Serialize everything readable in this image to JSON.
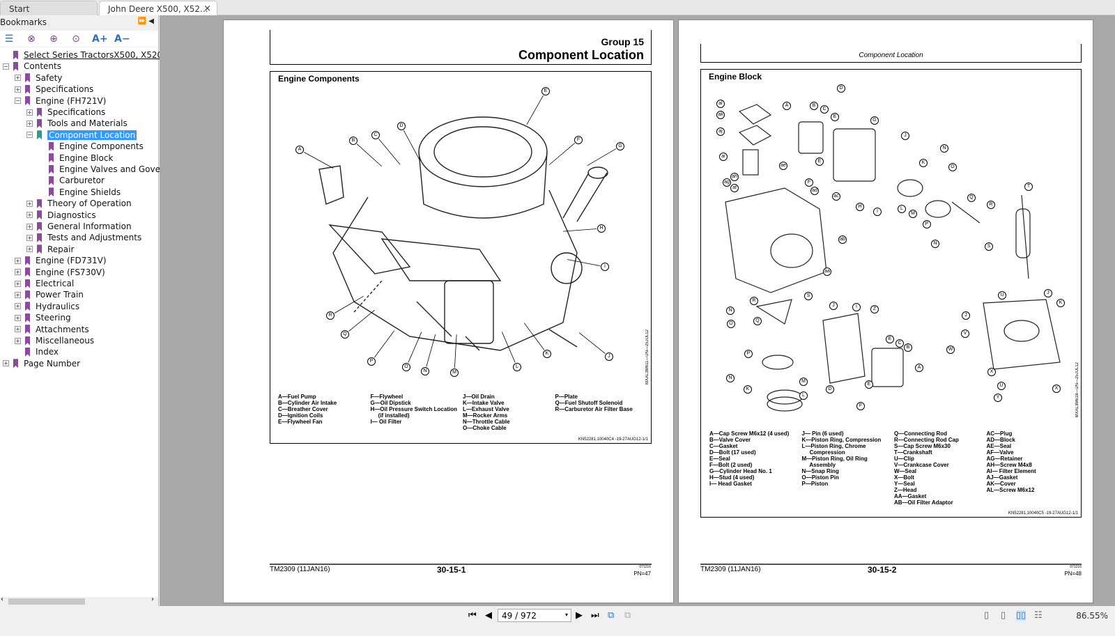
{
  "tabs": [
    {
      "label": "Start"
    },
    {
      "label": "John Deere X500, X52...",
      "close": "×"
    }
  ],
  "sidebar": {
    "title": "Bookmarks",
    "tools": [
      "bookmark-list",
      "remove-bookmark",
      "add-bookmark",
      "find-bookmark",
      "A+",
      "A−"
    ],
    "items": [
      {
        "label": "Select Series TractorsX500, X520, X5",
        "level": 0,
        "exp": "",
        "link": true
      },
      {
        "label": "Contents",
        "level": 0,
        "exp": "−"
      },
      {
        "label": "Safety",
        "level": 1,
        "exp": "+"
      },
      {
        "label": "Specifications",
        "level": 1,
        "exp": "+"
      },
      {
        "label": "Engine (FH721V)",
        "level": 1,
        "exp": "−"
      },
      {
        "label": "Specifications",
        "level": 2,
        "exp": "+"
      },
      {
        "label": "Tools and Materials",
        "level": 2,
        "exp": "+"
      },
      {
        "label": "Component Location",
        "level": 2,
        "exp": "−",
        "selected": true
      },
      {
        "label": "Engine Components",
        "level": 3,
        "exp": ""
      },
      {
        "label": "Engine Block",
        "level": 3,
        "exp": ""
      },
      {
        "label": "Engine Valves and Governo",
        "level": 3,
        "exp": ""
      },
      {
        "label": "Carburetor",
        "level": 3,
        "exp": ""
      },
      {
        "label": "Engine Shields",
        "level": 3,
        "exp": ""
      },
      {
        "label": "Theory of Operation",
        "level": 2,
        "exp": "+"
      },
      {
        "label": "Diagnostics",
        "level": 2,
        "exp": "+"
      },
      {
        "label": "General Information",
        "level": 2,
        "exp": "+"
      },
      {
        "label": "Tests and Adjustments",
        "level": 2,
        "exp": "+"
      },
      {
        "label": "Repair",
        "level": 2,
        "exp": "+"
      },
      {
        "label": "Engine (FD731V)",
        "level": 1,
        "exp": "+"
      },
      {
        "label": "Engine (FS730V)",
        "level": 1,
        "exp": "+"
      },
      {
        "label": "Electrical",
        "level": 1,
        "exp": "+"
      },
      {
        "label": "Power Train",
        "level": 1,
        "exp": "+"
      },
      {
        "label": "Hydraulics",
        "level": 1,
        "exp": "+"
      },
      {
        "label": "Steering",
        "level": 1,
        "exp": "+"
      },
      {
        "label": "Attachments",
        "level": 1,
        "exp": "+"
      },
      {
        "label": "Miscellaneous",
        "level": 1,
        "exp": "+"
      },
      {
        "label": "Index",
        "level": 1,
        "exp": ""
      },
      {
        "label": "Page Number",
        "level": 0,
        "exp": "+"
      }
    ]
  },
  "page1": {
    "group": "Group 15",
    "title": "Component Location",
    "fig_title": "Engine Components",
    "side_code": "MXAL3M611—UN—25JUL12",
    "fig_code": "KN52281,10040C4 -19-27AUG12-1/1",
    "callouts": [
      "E",
      "D",
      "C",
      "B",
      "A",
      "F",
      "G",
      "H",
      "I",
      "J",
      "K",
      "L",
      "M",
      "N",
      "O",
      "P",
      "Q",
      "R"
    ],
    "legend": [
      [
        "A—Fuel Pump",
        "B—Cylinder Air Intake",
        "C—Breather Cover",
        "D—Ignition Coils",
        "E—Flywheel Fan"
      ],
      [
        "F—Flywheel",
        "G—Oil Dipstick",
        "H—Oil Pressure Switch Location",
        "     (if installed)",
        "I— Oil Filter"
      ],
      [
        "J—Oil Drain",
        "K—Intake Valve",
        "L—Exhaust Valve",
        "M—Rocker Arms",
        "N—Throttle Cable",
        "O—Choke Cable"
      ],
      [
        "P—Plate",
        "Q—Fuel Shutoff Solenoid",
        "R—Carburetor Air Filter Base"
      ]
    ],
    "footer_left": "TM2309 (11JAN16)",
    "footer_center": "30-15-1",
    "footer_right_top": "071216",
    "footer_right": "PN=47"
  },
  "page2": {
    "header": "Component Location",
    "fig_title": "Engine Block",
    "side_code": "MXAL3M618—UN—25JUL12",
    "fig_code": "KN52281,10040C5 -19-27AUG12-1/1",
    "callouts": [
      "D",
      "al",
      "ak",
      "aj",
      "A",
      "B",
      "C",
      "E",
      "G",
      "J",
      "ai",
      "ah",
      "ag",
      "af",
      "ae",
      "E",
      "K",
      "N",
      "O",
      "F",
      "ad",
      "ac",
      "H",
      "I",
      "L",
      "M",
      "P",
      "Q",
      "R",
      "T",
      "N",
      "S",
      "ab",
      "aa",
      "U",
      "J",
      "K",
      "R",
      "S",
      "N",
      "Q",
      "O",
      "J",
      "I",
      "Z",
      "V",
      "J",
      "W",
      "P",
      "E",
      "C",
      "B",
      "A",
      "N",
      "M",
      "K",
      "L",
      "D",
      "E",
      "X",
      "U",
      "X",
      "Y",
      "F"
    ],
    "legend": [
      [
        "A—Cap Screw M6x12 (4 used)",
        "B—Valve Cover",
        "C—Gasket",
        "D—Bolt (17 used)",
        "E—Seal",
        "F—Bolt (2 used)",
        "G—Cylinder Head No. 1",
        "H—Stud (4 used)",
        "I— Head Gasket"
      ],
      [
        "J— Pin (6 used)",
        "K—Piston Ring, Compression",
        "L—Piston Ring, Chrome",
        "     Compression",
        "M—Piston Ring, Oil Ring",
        "     Assembly",
        "N—Snap Ring",
        "O—Piston Pin",
        "P—Piston"
      ],
      [
        "Q—Connecting Rod",
        "R—Connecting Rod Cap",
        "S—Cap Screw M6x30",
        "T—Crankshaft",
        "U—Clip",
        "V—Crankcase Cover",
        "W—Seal",
        "X—Bolt",
        "Y—Seal",
        "Z—Head",
        "AA—Gasket",
        "AB—Oil Filter Adaptor"
      ],
      [
        "AC—Plug",
        "AD—Block",
        "AE—Seal",
        "AF—Valve",
        "AG—Retainer",
        "AH—Screw M4x8",
        "AI— Filter Element",
        "AJ—Gasket",
        "AK—Cover",
        "AL—Screw M6x12"
      ]
    ],
    "footer_left": "TM2309 (11JAN16)",
    "footer_center": "30-15-2",
    "footer_right_top": "071216",
    "footer_right": "PN=48"
  },
  "statusbar": {
    "page_input": "49 / 972",
    "zoom": "86.55%",
    "nav": [
      "⏮",
      "◀",
      "▶",
      "⏭"
    ]
  }
}
